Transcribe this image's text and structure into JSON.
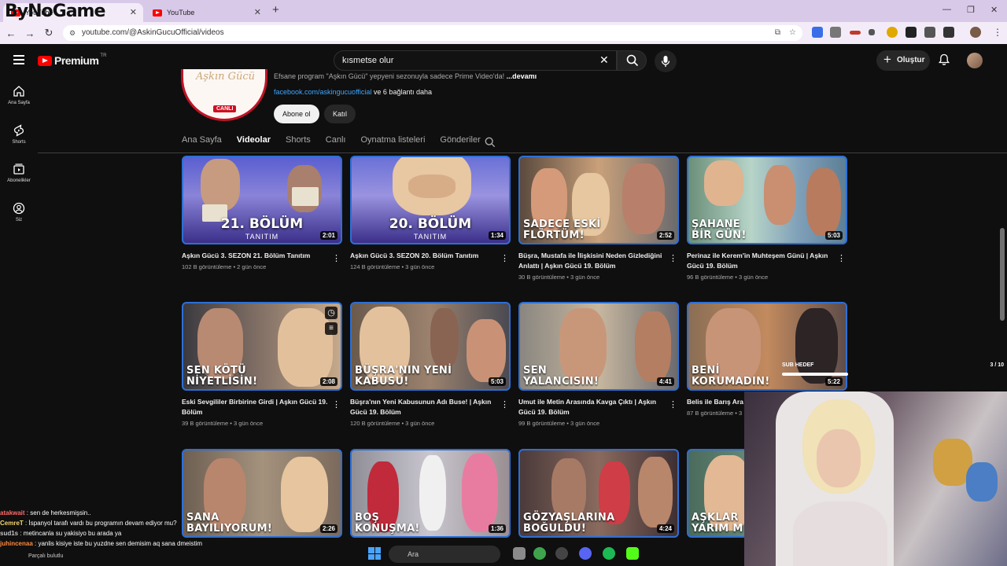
{
  "browser": {
    "overlay_logo": "ByNoGame",
    "tabs": [
      {
        "title": "YouTube",
        "active": true
      },
      {
        "title": "YouTube",
        "active": false
      }
    ],
    "url": "youtube.com/@AskinGucuOfficial/videos"
  },
  "header": {
    "logo_text": "Premium",
    "logo_region": "TR",
    "search_value": "kısmetse olur",
    "create_label": "Oluştur"
  },
  "sidebar": {
    "items": [
      {
        "label": "Ana Sayfa",
        "icon": "home-icon"
      },
      {
        "label": "Shorts",
        "icon": "shorts-icon"
      },
      {
        "label": "Abonelikler",
        "icon": "subscriptions-icon"
      },
      {
        "label": "Siz",
        "icon": "you-icon"
      }
    ]
  },
  "channel": {
    "avatar_script": "Aşkın Gücü",
    "live_badge": "CANLI",
    "desc_prefix": "Efsane program \"Aşkın Gücü\" yepyeni sezonuyla sadece Prime Video'da!",
    "desc_more": "...devamı",
    "link": "facebook.com/askingucuofficial",
    "link_suffix": "ve 6 bağlantı daha",
    "subscribe_label": "Abone ol",
    "join_label": "Katıl"
  },
  "tabs": [
    "Ana Sayfa",
    "Videolar",
    "Shorts",
    "Canlı",
    "Oynatma listeleri",
    "Gönderiler"
  ],
  "active_tab": "Videolar",
  "videos": [
    {
      "caption": "21. BÖLÜM",
      "sub": "TANITIM",
      "duration": "2:01",
      "title": "Aşkın Gücü 3. SEZON 21. Bölüm Tanıtım",
      "meta": "102 B görüntüleme • 2 gün önce"
    },
    {
      "caption": "20. BÖLÜM",
      "sub": "TANITIM",
      "duration": "1:34",
      "title": "Aşkın Gücü 3. SEZON 20. Bölüm Tanıtım",
      "meta": "124 B görüntüleme • 3 gün önce"
    },
    {
      "caption": "SADECE ESKİ FLÖRTÜM!",
      "sub": "",
      "duration": "2:52",
      "title": "Büşra, Mustafa ile İlişkisini Neden Gizlediğini Anlattı | Aşkın Gücü 19. Bölüm",
      "meta": "30 B görüntüleme • 3 gün önce"
    },
    {
      "caption": "ŞAHANE BİR GÜN!",
      "sub": "",
      "duration": "5:03",
      "title": "Perinaz ile Kerem'in Muhteşem Günü | Aşkın Gücü 19. Bölüm",
      "meta": "96 B görüntüleme • 3 gün önce"
    },
    {
      "caption": "SEN KÖTÜ NİYETLİSİN!",
      "sub": "",
      "duration": "2:08",
      "title": "Eski Sevgililer Birbirine Girdi | Aşkın Gücü 19. Bölüm",
      "meta": "39 B görüntüleme • 3 gün önce"
    },
    {
      "caption": "BÜŞRA'NIN YENİ KABUSU!",
      "sub": "",
      "duration": "5:03",
      "title": "Büşra'nın Yeni Kabusunun Adı Buse! | Aşkın Gücü 19. Bölüm",
      "meta": "120 B görüntüleme • 3 gün önce"
    },
    {
      "caption": "SEN YALANCISIN!",
      "sub": "",
      "duration": "4:41",
      "title": "Umut ile Metin Arasında Kavga Çıktı | Aşkın Gücü 19. Bölüm",
      "meta": "99 B görüntüleme • 3 gün önce"
    },
    {
      "caption": "BENİ KORUMADIN!",
      "sub": "",
      "duration": "5:22",
      "title": "Belis ile Barış Ara",
      "meta": "87 B görüntüleme • 3"
    },
    {
      "caption": "SANA BAYILIYORUM!",
      "sub": "",
      "duration": "2:26",
      "title": "",
      "meta": ""
    },
    {
      "caption": "BOŞ KONUŞMA!",
      "sub": "",
      "duration": "1:36",
      "title": "",
      "meta": ""
    },
    {
      "caption": "GÖZYAŞLARINA BOĞULDU!",
      "sub": "",
      "duration": "4:24",
      "title": "",
      "meta": ""
    },
    {
      "caption": "AŞKLAR YARIM M",
      "sub": "",
      "duration": "",
      "title": "",
      "meta": ""
    }
  ],
  "stream_overlay": {
    "sub_goal_label": "SUB HEDEF",
    "sub_goal_count": "3 / 10",
    "sub_goal_progress": 0.3
  },
  "chat": [
    {
      "user": "atakwait",
      "msg": "sen de herkesmişsin.."
    },
    {
      "user": "CemreT",
      "msg": "İspanyol tarafı vardı bu programın devam ediyor mu?"
    },
    {
      "user": "sud1s",
      "msg": "metincanla su yakisiyo bu arada ya"
    },
    {
      "user": "juhincenaa",
      "msg": "yanlis kisiye iste bu yuzdne sen demisim aq sana dmeistim"
    }
  ],
  "chat_footer": "Parçalı bulutlu",
  "taskbar": {
    "search_placeholder": "Ara"
  },
  "colors": {
    "bg": "#0f0f0f",
    "accent_red": "#ff0000",
    "thumb_border": "#2d6fd6",
    "link": "#3ea6ff"
  }
}
